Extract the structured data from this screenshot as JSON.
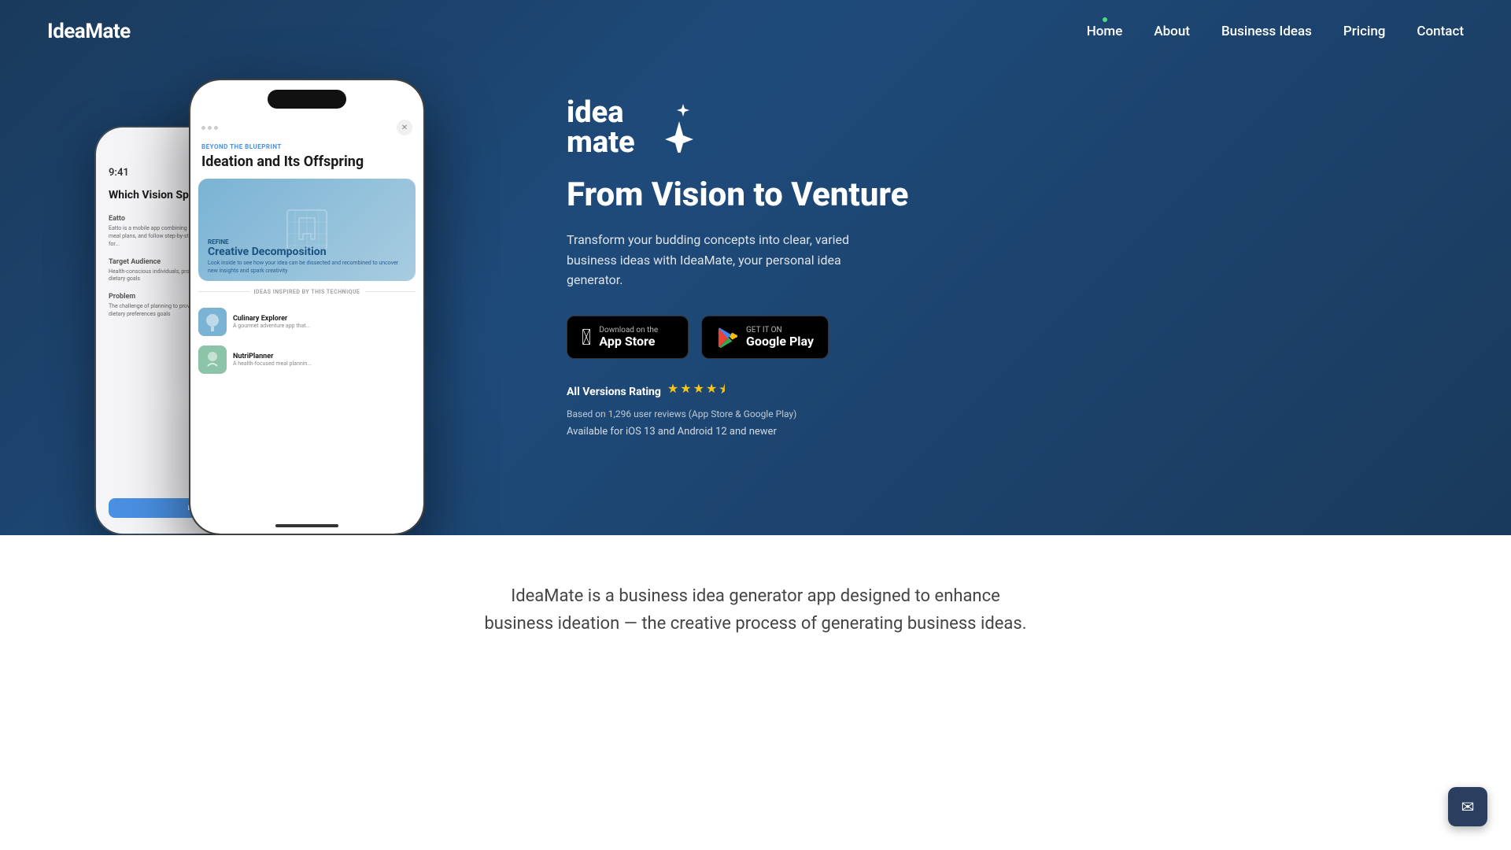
{
  "nav": {
    "logo": "IdeaMate",
    "links": [
      {
        "id": "home",
        "label": "Home",
        "active": true
      },
      {
        "id": "about",
        "label": "About",
        "active": false
      },
      {
        "id": "business-ideas",
        "label": "Business Ideas",
        "active": false
      },
      {
        "id": "pricing",
        "label": "Pricing",
        "active": false
      },
      {
        "id": "contact",
        "label": "Contact",
        "active": false
      }
    ]
  },
  "hero": {
    "brand_line1": "idea",
    "brand_line2": "mate",
    "headline": "From Vision to Venture",
    "subtitle": "Transform your budding concepts into clear, varied business ideas with IdeaMate, your personal idea generator.",
    "app_store": {
      "sub": "Download on the",
      "name": "App Store"
    },
    "google_play": {
      "sub": "GET IT ON",
      "name": "Google Play"
    },
    "rating": {
      "label": "All Versions Rating",
      "stars": 4.5,
      "review_count": "1,296",
      "review_text": "Based on 1,296 user reviews (App Store & Google Play)"
    },
    "availability": "Available for iOS 13 and Android 12 and newer"
  },
  "phone_back": {
    "time": "9:41",
    "title": "Which Vision Speaks to You",
    "sections": [
      {
        "title": "Eatto",
        "text": "Eatto is a mobile app combining meal planning that let's use personalized meal plans, and follow step-by-step instructions for delightful dishes. Recipes for..."
      },
      {
        "title": "Target Audience",
        "text": "Health-conscious individuals, professionals, and families meal planning and dietary goals"
      },
      {
        "title": "Problem",
        "text": "The challenge of planning to provide dietary preferences while balancing dietary preferences goals"
      }
    ],
    "btn_label": "Develop C..."
  },
  "phone_front": {
    "tag": "BEYOND THE BLUEPRINT",
    "title": "Ideation and Its Offspring",
    "card": {
      "label": "REFINE",
      "name": "Creative Decomposition",
      "desc": "Look inside to see how your idea can be dissected and recombined to uncover new insights and spark creativity"
    },
    "divider_text": "IDEAS INSPIRED BY THIS TECHNIQUE",
    "ideas": [
      {
        "name": "Culinary Explorer",
        "desc": "A gourmet adventure app that..."
      },
      {
        "name": "NutriPlanner",
        "desc": "A health-focused meal plannin..."
      }
    ]
  },
  "below_fold": {
    "text": "IdeaMate is a business idea generator app designed to enhance business ideation — the creative process of generating business ideas."
  },
  "mail": {
    "label": "Contact email button"
  }
}
